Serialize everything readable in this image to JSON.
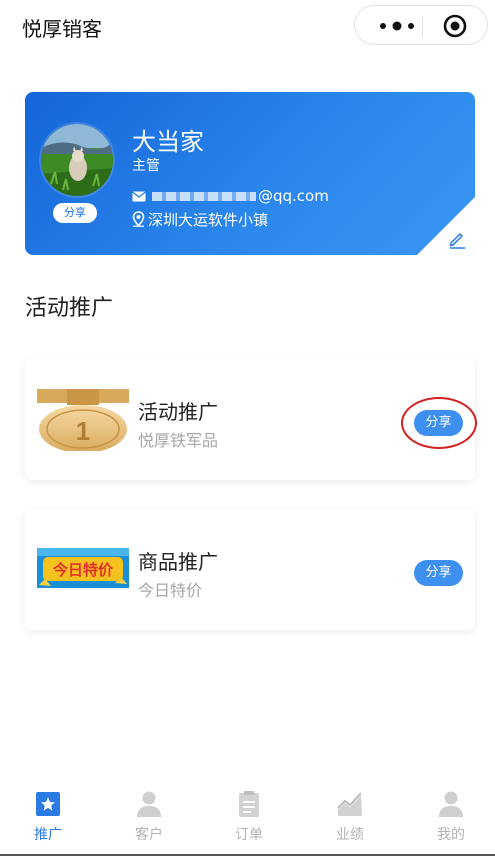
{
  "app": {
    "title": "悦厚销客"
  },
  "profile": {
    "name": "大当家",
    "role": "主管",
    "email_visible": "@qq.com",
    "address": "深圳大运软件小镇",
    "share_label": "分享"
  },
  "section": {
    "title": "活动推广"
  },
  "promos": [
    {
      "title": "活动推广",
      "subtitle": "悦厚铁军品",
      "share_label": "分享",
      "thumb_text": "1"
    },
    {
      "title": "商品推广",
      "subtitle": "今日特价",
      "share_label": "分享",
      "thumb_text": "今日特价"
    }
  ],
  "tabs": [
    {
      "label": "推广",
      "icon": "star-bookmark-icon",
      "active": true
    },
    {
      "label": "客户",
      "icon": "person-icon",
      "active": false
    },
    {
      "label": "订单",
      "icon": "clipboard-icon",
      "active": false
    },
    {
      "label": "业绩",
      "icon": "chart-icon",
      "active": false
    },
    {
      "label": "我的",
      "icon": "user-icon",
      "active": false
    }
  ],
  "colors": {
    "accent": "#2c7be5",
    "card_gradient_start": "#1565d8",
    "card_gradient_end": "#3b97f3",
    "share_button": "#3d8ff0",
    "highlight": "#d42020",
    "tab_inactive": "#b3b3b3"
  }
}
